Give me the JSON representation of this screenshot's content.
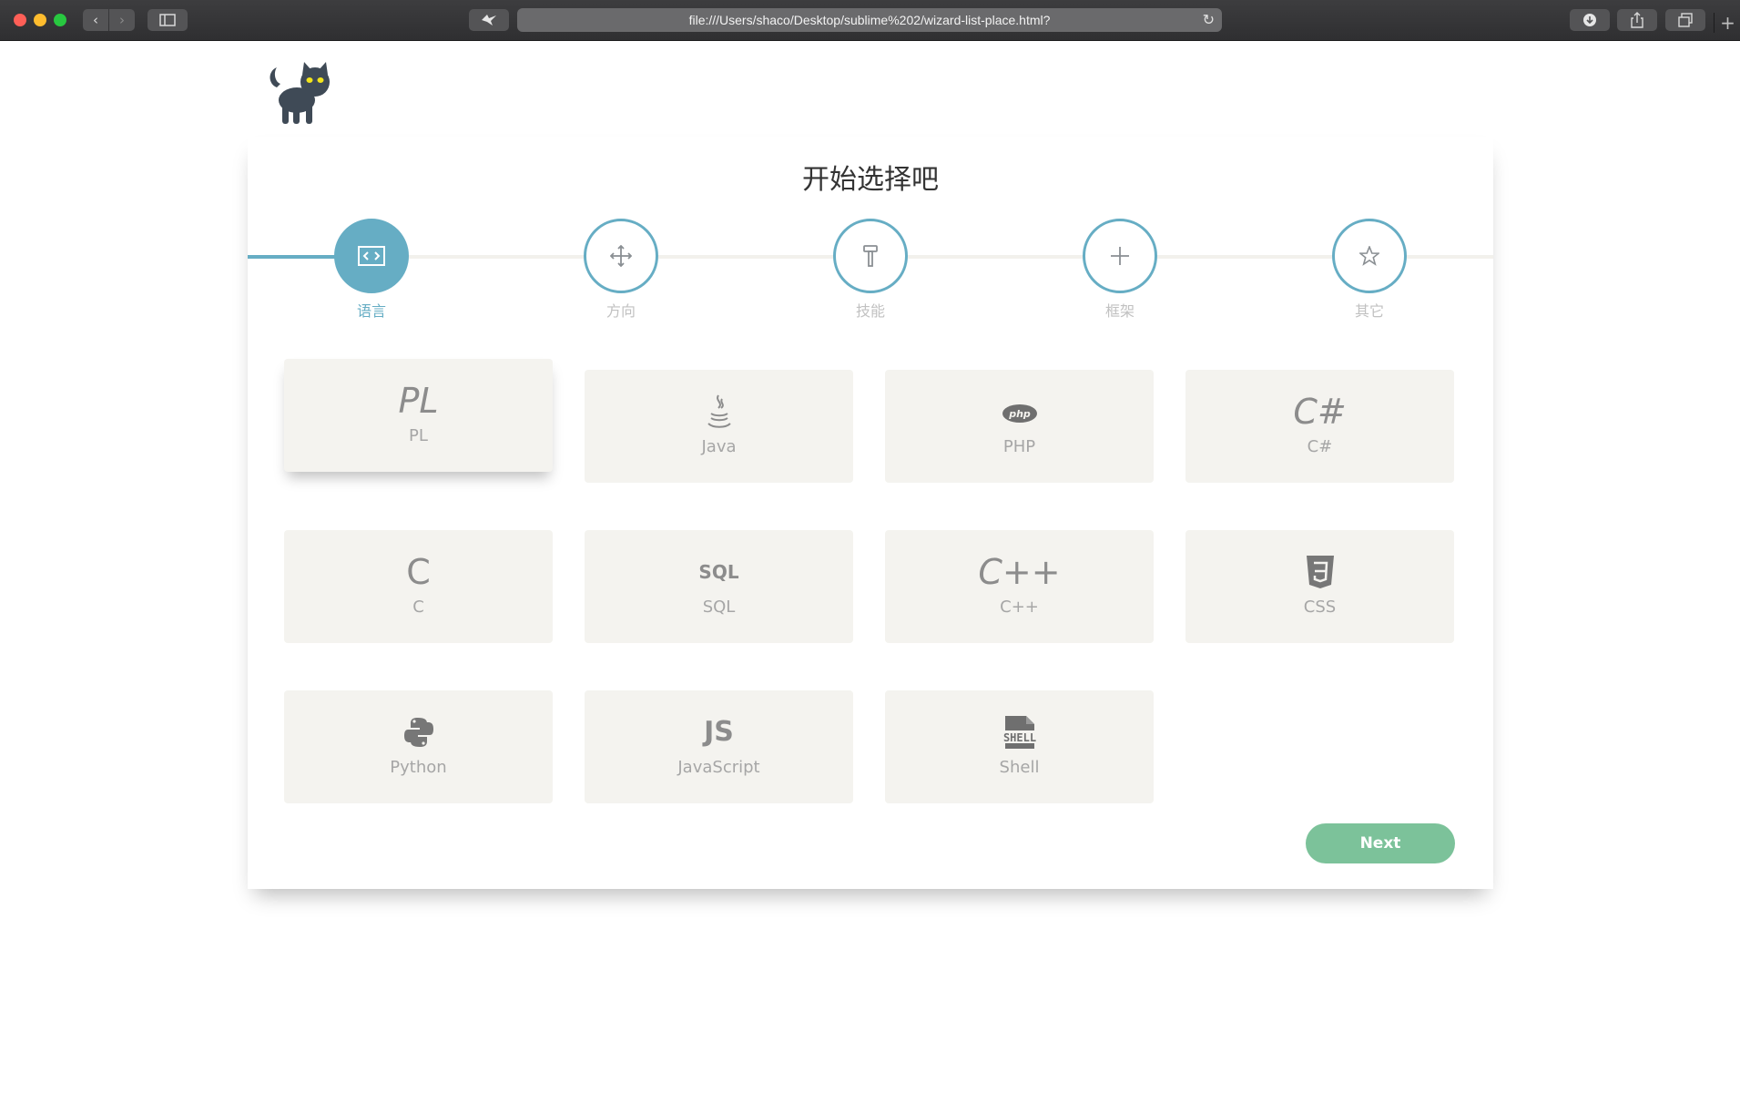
{
  "browser": {
    "url": "file:///Users/shaco/Desktop/sublime%202/wizard-list-place.html?",
    "icons": {
      "back": "chevron-left-icon",
      "forward": "chevron-right-icon",
      "sidebar": "sidebar-icon",
      "bird": "bird-icon",
      "reload": "reload-icon",
      "download": "download-icon",
      "share": "share-icon",
      "tabs": "tabs-overview-icon",
      "new_tab": "plus-icon"
    }
  },
  "page": {
    "title": "开始选择吧",
    "logo_icon": "cat-icon"
  },
  "wizard": {
    "active_step": 0,
    "steps": [
      {
        "label": "语言",
        "icon": "code-icon"
      },
      {
        "label": "方向",
        "icon": "move-icon"
      },
      {
        "label": "技能",
        "icon": "hammer-icon"
      },
      {
        "label": "框架",
        "icon": "plus-icon"
      },
      {
        "label": "其它",
        "icon": "star-icon"
      }
    ]
  },
  "languages": {
    "selected": "PL",
    "items": [
      {
        "name": "PL",
        "glyph": "PL",
        "icon": "pl-icon"
      },
      {
        "name": "Java",
        "glyph": "",
        "icon": "java-icon"
      },
      {
        "name": "PHP",
        "glyph": "php",
        "icon": "php-icon"
      },
      {
        "name": "C#",
        "glyph": "C#",
        "icon": "csharp-icon"
      },
      {
        "name": "C",
        "glyph": "C",
        "icon": "c-icon"
      },
      {
        "name": "SQL",
        "glyph": "SQL",
        "icon": "sql-icon"
      },
      {
        "name": "C++",
        "glyph": "C++",
        "icon": "cplusplus-icon"
      },
      {
        "name": "CSS",
        "glyph": "",
        "icon": "css3-icon"
      },
      {
        "name": "Python",
        "glyph": "",
        "icon": "python-icon"
      },
      {
        "name": "JavaScript",
        "glyph": "JS",
        "icon": "javascript-icon"
      },
      {
        "name": "Shell",
        "glyph": "",
        "icon": "shell-icon"
      }
    ]
  },
  "actions": {
    "next_label": "Next"
  },
  "colors": {
    "accent": "#66adc4",
    "next_button": "#7cc29a",
    "tile_bg": "#f4f3ef"
  }
}
